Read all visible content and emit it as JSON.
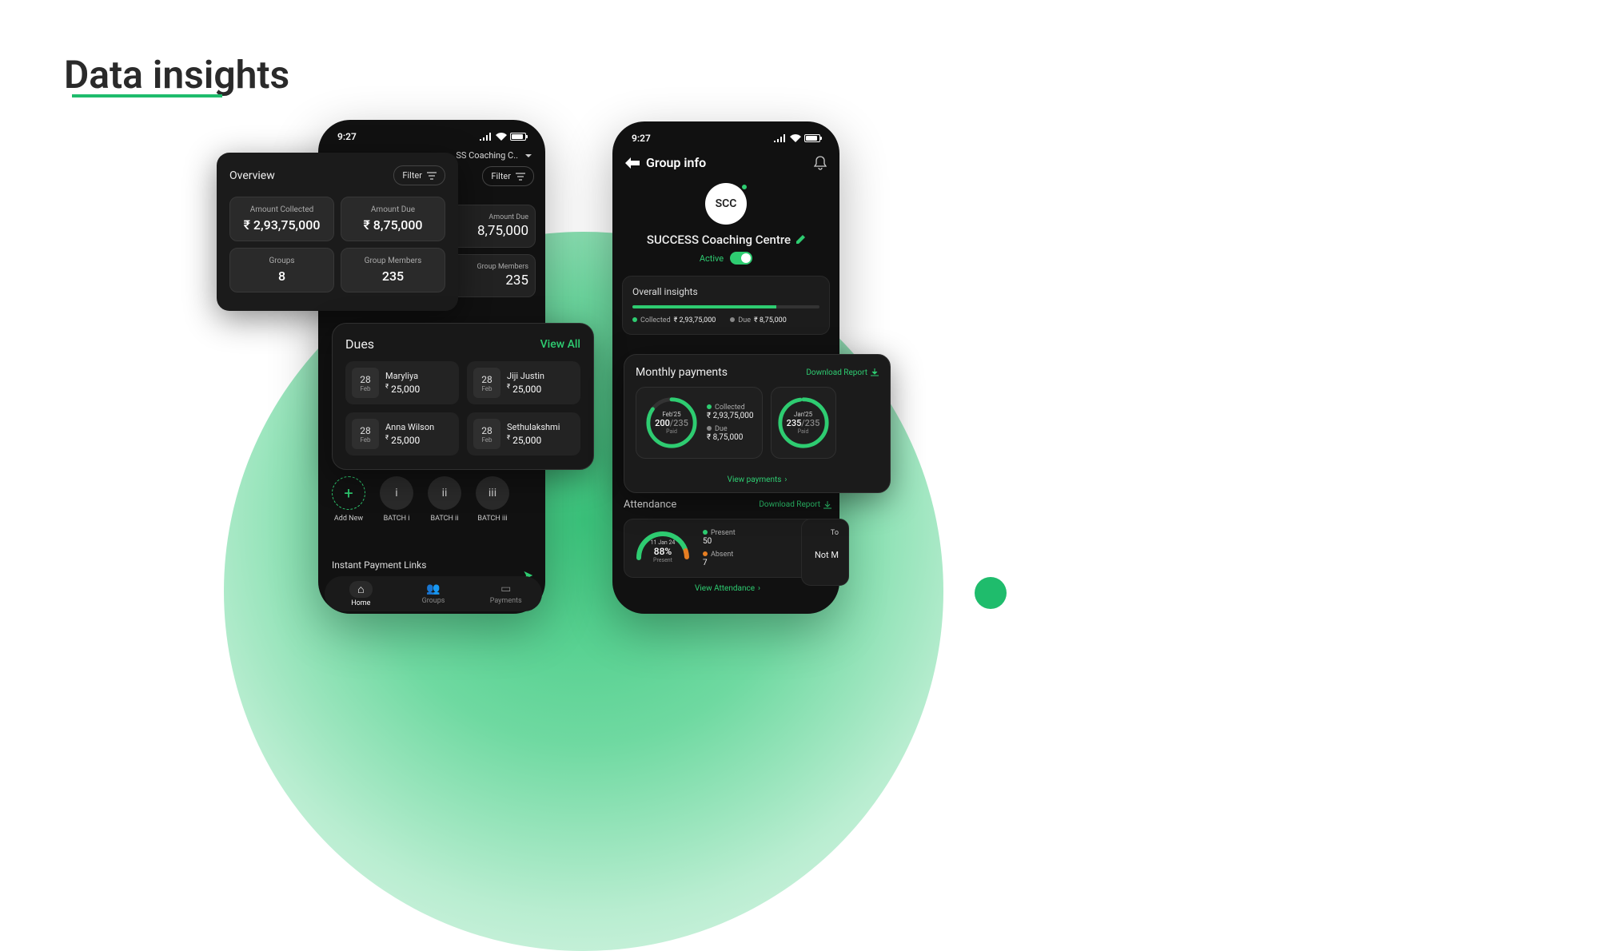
{
  "page": {
    "title": "Data insights"
  },
  "status": {
    "time": "9:27"
  },
  "phone1": {
    "coaching_name": "SS Coaching C..",
    "filter": "Filter",
    "amount_due_label": "Amount Due",
    "amount_due": "8,75,000",
    "members_label": "Group Members",
    "members": "235",
    "ipl": "Instant Payment Links",
    "nav": {
      "home": "Home",
      "groups": "Groups",
      "payments": "Payments"
    }
  },
  "overview": {
    "title": "Overview",
    "filter": "Filter",
    "stats": {
      "collected_label": "Amount Collected",
      "collected": "₹ 2,93,75,000",
      "due_label": "Amount Due",
      "due": "₹ 8,75,000",
      "groups_label": "Groups",
      "groups": "8",
      "members_label": "Group Members",
      "members": "235"
    }
  },
  "dues": {
    "title": "Dues",
    "view_all": "View All",
    "items": [
      {
        "day": "28",
        "month": "Feb",
        "name": "Maryliya",
        "amount": "25,000"
      },
      {
        "day": "28",
        "month": "Feb",
        "name": "Jiji Justin",
        "amount": "25,000"
      },
      {
        "day": "28",
        "month": "Feb",
        "name": "Anna Wilson",
        "amount": "25,000"
      },
      {
        "day": "28",
        "month": "Feb",
        "name": "Sethulakshmi",
        "amount": "25,000"
      }
    ]
  },
  "batches": {
    "add": "Add New",
    "items": [
      "BATCH i",
      "BATCH ii",
      "BATCH iii"
    ],
    "icons": [
      "i",
      "ii",
      "iii"
    ]
  },
  "group_info": {
    "title": "Group info",
    "avatar": "SCC",
    "name": "SUCCESS Coaching Centre",
    "active": "Active",
    "insights": {
      "title": "Overall insights",
      "collected_label": "Collected",
      "collected": "₹ 2,93,75,000",
      "due_label": "Due",
      "due": "₹ 8,75,000"
    }
  },
  "monthly": {
    "title": "Monthly payments",
    "download": "Download Report",
    "view": "View payments",
    "feb": {
      "month": "Feb'25",
      "paid": "200",
      "total": "235",
      "paid_label": "Paid",
      "collected_label": "Collected",
      "collected": "₹ 2,93,75,000",
      "due_label": "Due",
      "due": "₹ 8,75,000"
    },
    "jan": {
      "month": "Jan'25",
      "paid": "235",
      "total": "235",
      "paid_label": "Paid"
    }
  },
  "attendance": {
    "title": "Attendance",
    "download": "Download Report",
    "view": "View Attendance",
    "card": {
      "date": "11 Jan 24",
      "pct": "88%",
      "label": "Present",
      "present_label": "Present",
      "present": "50",
      "absent_label": "Absent",
      "absent": "7"
    },
    "card2": {
      "title": "To",
      "value": "Not M"
    }
  }
}
